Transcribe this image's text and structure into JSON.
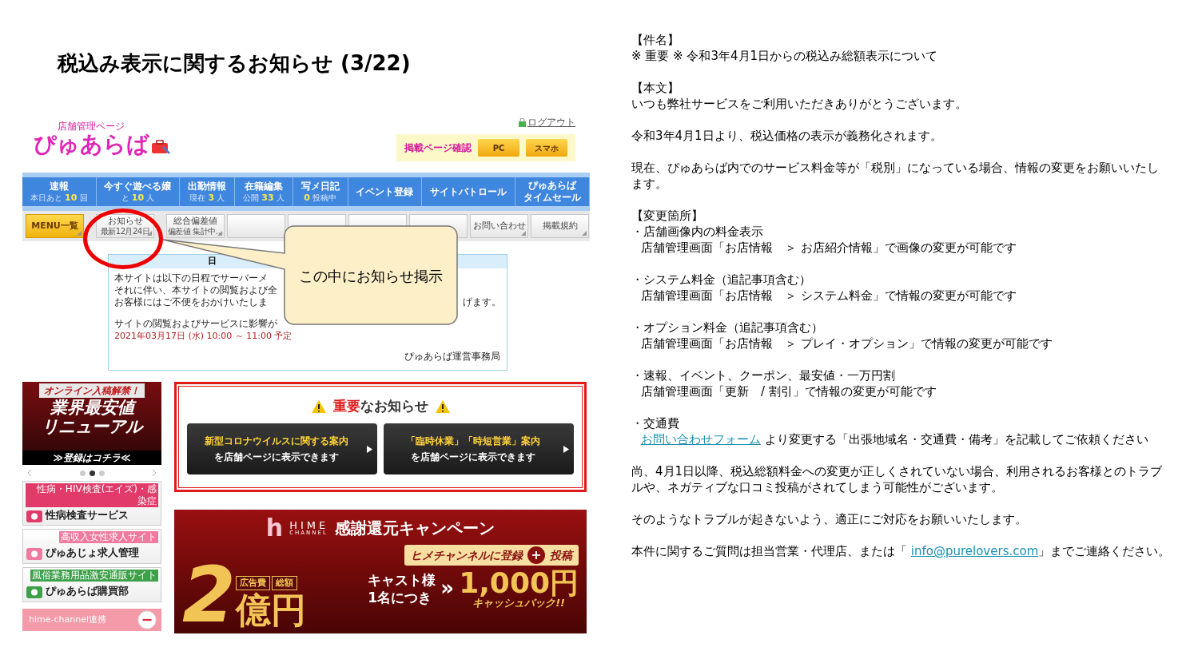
{
  "slide_title": "税込み表示に関するお知らせ (3/22)",
  "screenshot": {
    "header": {
      "logo_small": "店舗管理ページ",
      "logo": "ぴゅあらば",
      "logout": "ログアウト",
      "preview_label": "掲載ページ確認",
      "preview_buttons": [
        "PC",
        "スマホ"
      ]
    },
    "nav": [
      {
        "kind": "counter",
        "title": "速報",
        "sub": "本日あと **10** 回"
      },
      {
        "kind": "counter",
        "title": "今すぐ遊べる嬢",
        "sub": "と **10** 人"
      },
      {
        "kind": "counter",
        "title": "出勤情報",
        "sub": "現在 **3** 人"
      },
      {
        "kind": "counter",
        "title": "在籍編集",
        "sub": "公開 **33** 人"
      },
      {
        "kind": "counter",
        "title": "写メ日記",
        "sub": "**0** 投稿中"
      },
      {
        "kind": "label",
        "lines": [
          "イベント登録"
        ]
      },
      {
        "kind": "label",
        "lines": [
          "サイトパトロール"
        ]
      },
      {
        "kind": "label",
        "lines": [
          "ぴゅあらば",
          "タイムセール"
        ]
      }
    ],
    "menu": [
      {
        "kind": "primary",
        "label": "MENU一覧"
      },
      {
        "kind": "dated",
        "label": "お知らせ",
        "sub": "最新12月24日"
      },
      {
        "kind": "dated",
        "label": "総合偏差値",
        "sub": "偏差値 集計中…"
      },
      {
        "kind": "hidden"
      },
      {
        "kind": "hidden"
      },
      {
        "kind": "hidden"
      },
      {
        "kind": "hidden"
      },
      {
        "kind": "plain",
        "label": "お問い合わせ"
      },
      {
        "kind": "plain",
        "label": "掲載規約"
      }
    ],
    "notice": {
      "title": "日",
      "lines": [
        {
          "kind": "plain",
          "text": "本サイトは以下の日程でサーバーメ"
        },
        {
          "kind": "plain",
          "text": "それに伴い、本サイトの閲覧および全"
        },
        {
          "kind": "plain",
          "text": "お客様にはご不便をおかけいたしま",
          "tail": "げます。"
        },
        {
          "kind": "gap"
        },
        {
          "kind": "plain",
          "text": "サイトの閲覧およびサービスに影響が"
        },
        {
          "kind": "date",
          "text": "2021年03月17日 (水) 10:00 ～ 11:00 予定"
        }
      ],
      "signature": "ぴゅあらば運営事務局"
    },
    "side_banner": {
      "top": "オンライン入稿解禁！",
      "line1": "業界最安値",
      "line2": "リニューアル",
      "cta": "≫登録はコチラ≪"
    },
    "carousel_dots": [
      {
        "selected": false
      },
      {
        "selected": true
      },
      {
        "selected": false
      }
    ],
    "side_links": [
      {
        "tag": "性病・HIV検査(エイズ)・感染症",
        "title": "性病検査サービス",
        "color": "#e23b6a"
      },
      {
        "tag": "高収入女性求人サイト",
        "title": "ぴゅあじょ求人管理",
        "color": "#f07aa0"
      },
      {
        "tag": "風俗業務用品激安通販サイト",
        "title": "ぴゅあらば購買部",
        "color": "#3fa04a"
      }
    ],
    "side_footer": "hime-channel連携",
    "important": {
      "title": "**重要**なお知らせ",
      "buttons": [
        {
          "line1": "新型コロナウイルスに関する案内",
          "line2": "を店舗ページに表示できます"
        },
        {
          "line1": "「臨時休業」「時短営業」案内",
          "line2": "を店舗ページに表示できます"
        }
      ]
    },
    "campaign": {
      "mark": "h",
      "brand": "HIME",
      "brand_sub": "CHANNEL",
      "title": "感謝還元キャンペーン",
      "pill_left": "ヒメチャンネルに登録",
      "pill_plus": "+",
      "pill_right": "投稿",
      "big_digit": "2",
      "tags": [
        "広告費",
        "総額"
      ],
      "big_unit": "億円",
      "cast_1": "キャスト様",
      "cast_2": "1名につき",
      "arrow": "»",
      "amount": "1,000円",
      "cashback": "キャッシュバック!!"
    }
  },
  "callout": {
    "text": "この中にお知らせ掲示"
  },
  "email_body": [
    [
      {
        "kind": "plain",
        "text": "【件名】"
      },
      {
        "kind": "plain",
        "text": "※ 重要 ※ 令和3年4月1日からの税込み総額表示について"
      }
    ],
    [
      {
        "kind": "plain",
        "text": "【本文】"
      },
      {
        "kind": "plain",
        "text": "いつも弊社サービスをご利用いただきありがとうございます。"
      }
    ],
    [
      {
        "kind": "plain",
        "text": "令和3年4月1日より、税込価格の表示が義務化されます。"
      }
    ],
    [
      {
        "kind": "plain",
        "text": "現在、ぴゅあらば内でのサービス料金等が「税別」になっている場合、情報の変更をお願いいたします。"
      }
    ],
    [
      {
        "kind": "plain",
        "text": "【変更箇所】"
      },
      {
        "kind": "plain",
        "text": "・店舗画像内の料金表示"
      },
      {
        "kind": "indent",
        "text": "店舗管理画面「お店情報　＞ お店紹介情報」で画像の変更が可能です"
      }
    ],
    [
      {
        "kind": "plain",
        "text": "・システム料金（追記事項含む）"
      },
      {
        "kind": "indent",
        "text": "店舗管理画面「お店情報　＞ システム料金」で情報の変更が可能です"
      }
    ],
    [
      {
        "kind": "plain",
        "text": "・オプション料金（追記事項含む）"
      },
      {
        "kind": "indent",
        "text": "店舗管理画面「お店情報　＞ プレイ・オプション」で情報の変更が可能です"
      }
    ],
    [
      {
        "kind": "plain",
        "text": "・速報、イベント、クーポン、最安値・一万円割"
      },
      {
        "kind": "indent",
        "text": "店舗管理画面「更新　/ 割引」で情報の変更が可能です"
      }
    ],
    [
      {
        "kind": "plain",
        "text": "・交通費"
      },
      {
        "kind": "link_first",
        "link": "お問い合わせフォーム",
        "after": "より変更する「出張地域名・交通費・備考」を記載してご依頼ください"
      }
    ],
    [
      {
        "kind": "plain",
        "text": "尚、4月1日以降、税込総額料金への変更が正しくされていない場合、利用されるお客様とのトラブルや、ネガティブな口コミ投稿がされてしまう可能性がございます。"
      }
    ],
    [
      {
        "kind": "plain",
        "text": "そのようなトラブルが起きないよう、適正にご対応をお願いいたします。"
      }
    ],
    [
      {
        "kind": "link_mid",
        "text": "本件に関するご質問は担当営業・代理店、または「",
        "link": "info@purelovers.com",
        "after": "」までご連絡ください。"
      }
    ]
  ]
}
